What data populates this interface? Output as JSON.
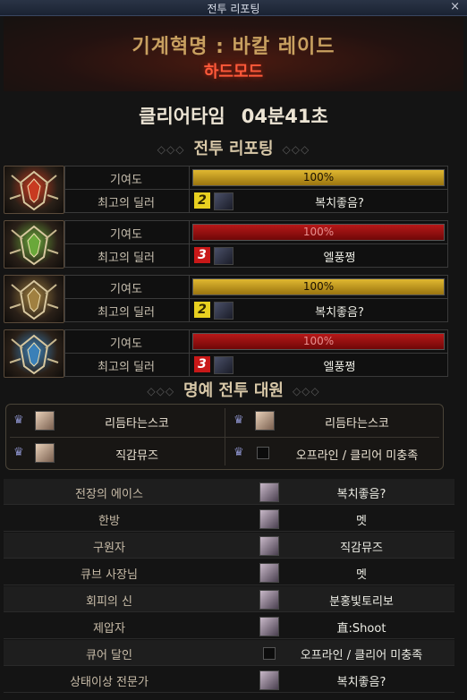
{
  "window": {
    "title": "전투 리포팅",
    "close_icon": "×"
  },
  "header": {
    "dungeon": "기계혁명 : 바칼 레이드",
    "mode": "하드모드"
  },
  "clear": {
    "label": "클리어타임",
    "time": "04분41초"
  },
  "report": {
    "title": "전투 리포팅",
    "contribution_label": "기여도",
    "top_dealer_label": "최고의 딜러",
    "teams": [
      {
        "emblem": "red-dragon-emblem",
        "emblem_color": "#c83a20",
        "contribution": "100%",
        "contribution_fraction": 1.0,
        "bar_color": "gold",
        "badge": "2",
        "badge_color": "#e8d020",
        "dealer": "복치좋음?"
      },
      {
        "emblem": "green-dragon-emblem",
        "emblem_color": "#6aa83a",
        "contribution": "100%",
        "contribution_fraction": 1.0,
        "bar_color": "red",
        "badge": "3",
        "badge_color": "#c81818",
        "dealer": "엘풍쩡"
      },
      {
        "emblem": "gold-dragon-emblem",
        "emblem_color": "#a08040",
        "contribution": "100%",
        "contribution_fraction": 1.0,
        "bar_color": "gold",
        "badge": "2",
        "badge_color": "#e8d020",
        "dealer": "복치좋음?"
      },
      {
        "emblem": "blue-dragon-emblem",
        "emblem_color": "#3a80b8",
        "contribution": "100%",
        "contribution_fraction": 1.0,
        "bar_color": "red",
        "badge": "3",
        "badge_color": "#c81818",
        "dealer": "엘풍쩡"
      }
    ]
  },
  "honor": {
    "title": "명예 전투 대원",
    "members": [
      {
        "name": "리듬타는스코",
        "offline": false
      },
      {
        "name": "리듬타는스코",
        "offline": false
      },
      {
        "name": "직감뮤즈",
        "offline": false
      },
      {
        "name": "오프라인 / 클리어 미충족",
        "offline": true
      }
    ]
  },
  "titles": [
    {
      "label": "전장의 에이스",
      "name": "복치좋음?",
      "offline": false
    },
    {
      "label": "한방",
      "name": "멧",
      "offline": false
    },
    {
      "label": "구원자",
      "name": "직감뮤즈",
      "offline": false
    },
    {
      "label": "큐브 사장님",
      "name": "멧",
      "offline": false
    },
    {
      "label": "회피의 신",
      "name": "분홍빛토리보",
      "offline": false
    },
    {
      "label": "제압자",
      "name": "直:Shoot",
      "offline": false
    },
    {
      "label": "큐어 달인",
      "name": "오프라인 / 클리어 미충족",
      "offline": true
    },
    {
      "label": "상태이상 전문가",
      "name": "복치좋음?",
      "offline": false
    }
  ],
  "colors": {
    "gold_bar": "#c89a20",
    "red_bar": "#9a1010",
    "mode_text": "#ff5a3a",
    "dungeon_text": "#c8a060"
  }
}
